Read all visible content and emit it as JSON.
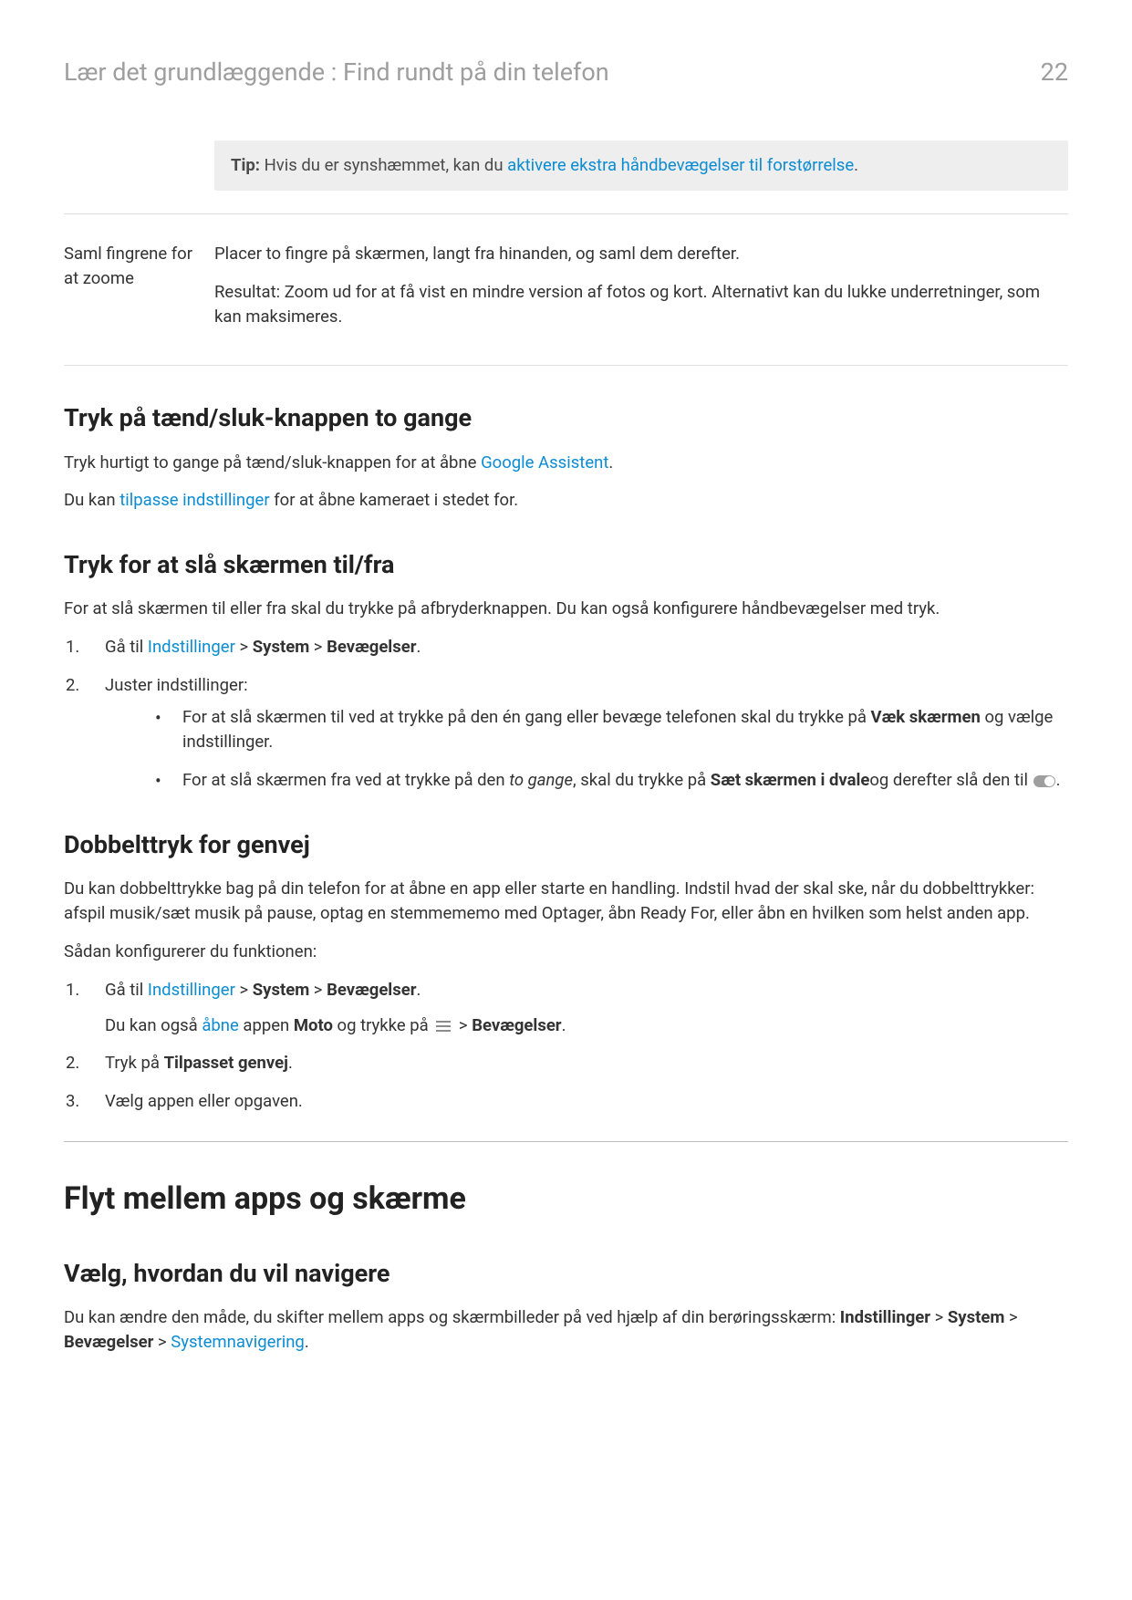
{
  "header": {
    "breadcrumb": "Lær det grundlæggende : Find rundt på din telefon",
    "pageNumber": "22"
  },
  "tip": {
    "label": "Tip:",
    "text": " Hvis du er synshæmmet, kan du ",
    "link": "aktivere ekstra håndbevægelser til forstørrelse",
    "period": "."
  },
  "row": {
    "left": "Saml fingrene for at zoome",
    "r1": "Placer to fingre på skærmen, langt fra hinanden, og saml dem derefter.",
    "r2": "Resultat: Zoom ud for at få vist en mindre version af fotos og kort. Alternativt kan du lukke underretninger, som kan maksimeres."
  },
  "s1": {
    "heading": "Tryk på tænd/sluk-knappen to gange",
    "p1a": "Tryk hurtigt to gange på tænd/sluk-knappen for at åbne ",
    "p1link": "Google Assistent",
    "p1b": ".",
    "p2a": "Du kan ",
    "p2link": "tilpasse indstillinger",
    "p2b": " for at åbne kameraet i stedet for."
  },
  "s2": {
    "heading": "Tryk for at slå skærmen til/fra",
    "p1": "For at slå skærmen til eller fra skal du trykke på afbryderknappen. Du kan også konfigurere håndbevægelser med tryk.",
    "li1a": "Gå til ",
    "li1link": "Indstillinger",
    "li1b": " > ",
    "li1bold1": "System",
    "li1c": " > ",
    "li1bold2": "Bevægelser",
    "li1d": ".",
    "li2": "Juster indstillinger:",
    "b1a": "For at slå skærmen til ved at trykke på den én gang eller bevæge telefonen skal du trykke på ",
    "b1bold": "Væk skærmen",
    "b1b": " og vælge indstillinger.",
    "b2a": "For at slå skærmen fra ved at trykke på den ",
    "b2ital": "to gange",
    "b2b": ", skal du trykke på ",
    "b2bold": "Sæt skærmen i dvale",
    "b2c": "og derefter slå den til ",
    "b2d": "."
  },
  "s3": {
    "heading": "Dobbelttryk for genvej",
    "p1": "Du kan dobbelttrykke bag på din telefon for at åbne en app eller starte en handling. Indstil hvad der skal ske, når du dobbelttrykker: afspil musik/sæt musik på pause, optag en stemmememo med Optager, åbn Ready For, eller åbn en hvilken som helst anden app.",
    "p2": "Sådan konfigurerer du funktionen:",
    "li1a": "Gå til ",
    "li1link": "Indstillinger",
    "li1b": " > ",
    "li1bold1": "System",
    "li1c": " > ",
    "li1bold2": "Bevægelser",
    "li1d": ".",
    "sub1a": "Du kan også ",
    "sub1link": "åbne",
    "sub1b": " appen ",
    "sub1bold": "Moto",
    "sub1c": " og trykke på ",
    "sub1d": " > ",
    "sub1bold2": "Bevægelser",
    "sub1e": ".",
    "li2a": "Tryk på ",
    "li2bold": "Tilpasset genvej",
    "li2b": ".",
    "li3": "Vælg appen eller opgaven."
  },
  "s4": {
    "bigHeading": "Flyt mellem apps og skærme",
    "heading": "Vælg, hvordan du vil navigere",
    "p1": "Du kan ændre den måde, du skifter mellem apps og skærmbilleder på ved hjælp af din berøringsskærm: ",
    "bold1": "Indstillinger",
    "s": " > ",
    "bold2": "System",
    "bold3": "Bevægelser",
    "link": "Systemnavigering",
    "period": "."
  }
}
